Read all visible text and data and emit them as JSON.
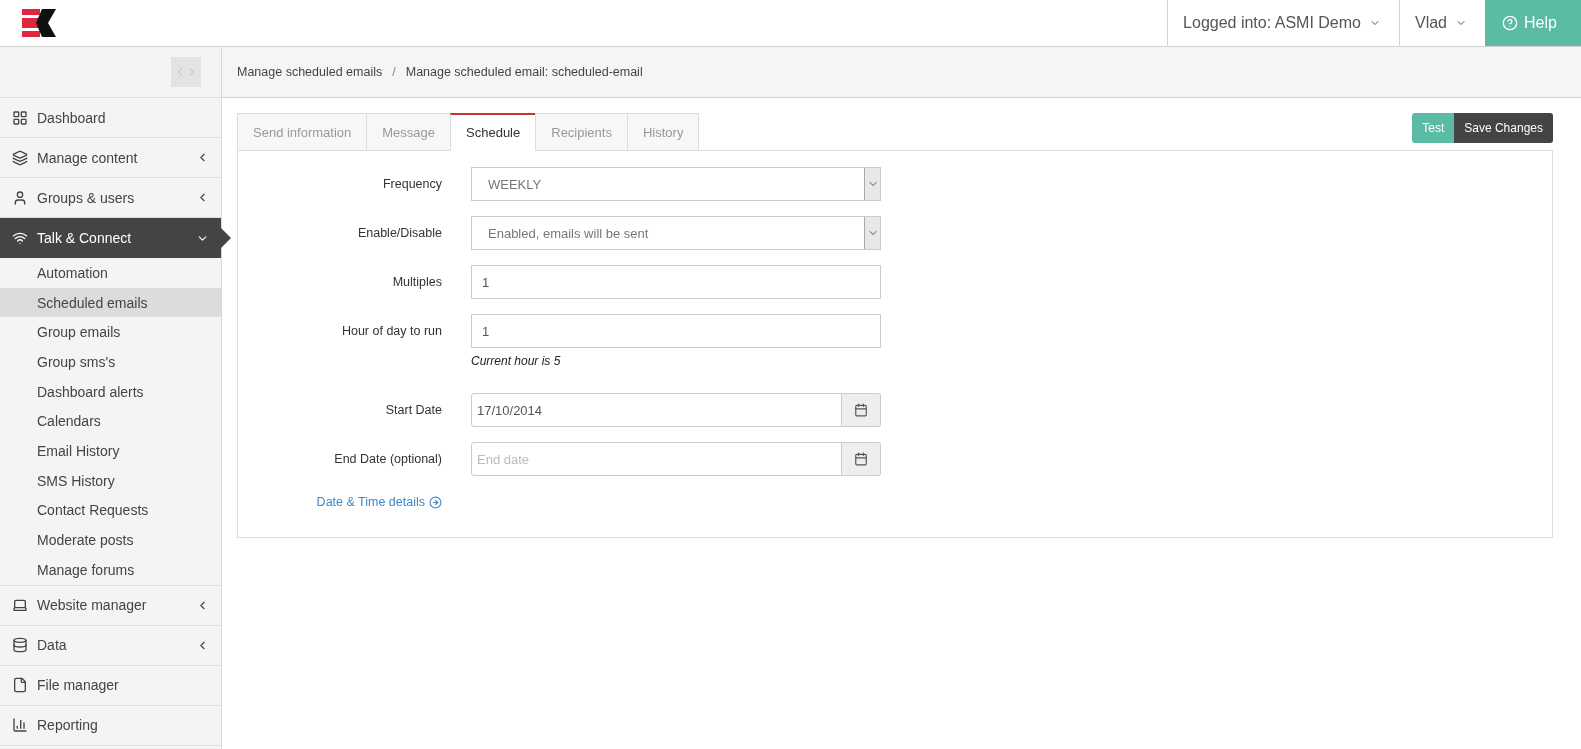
{
  "header": {
    "account_menu": "Logged into: ASMI Demo",
    "user_menu": "Vlad",
    "help_button": "Help"
  },
  "sidebar": {
    "items": [
      {
        "label": "Dashboard",
        "kind": "link",
        "selected": false
      },
      {
        "label": "Manage content",
        "kind": "menu",
        "selected": false,
        "expanded": false
      },
      {
        "label": "Groups & users",
        "kind": "menu",
        "selected": false,
        "expanded": false
      },
      {
        "label": "Talk & Connect",
        "kind": "menu",
        "selected": true,
        "expanded": true,
        "children": [
          {
            "label": "Automation",
            "selected": false
          },
          {
            "label": "Scheduled emails",
            "selected": true
          },
          {
            "label": "Group emails",
            "selected": false
          },
          {
            "label": "Group sms's",
            "selected": false
          },
          {
            "label": "Dashboard alerts",
            "selected": false
          },
          {
            "label": "Calendars",
            "selected": false
          },
          {
            "label": "Email History",
            "selected": false
          },
          {
            "label": "SMS History",
            "selected": false
          },
          {
            "label": "Contact Requests",
            "selected": false
          },
          {
            "label": "Moderate posts",
            "selected": false
          },
          {
            "label": "Manage forums",
            "selected": false
          }
        ]
      },
      {
        "label": "Website manager",
        "kind": "menu",
        "selected": false,
        "expanded": false
      },
      {
        "label": "Data",
        "kind": "menu",
        "selected": false,
        "expanded": false
      },
      {
        "label": "File manager",
        "kind": "link",
        "selected": false
      },
      {
        "label": "Reporting",
        "kind": "link",
        "selected": false
      }
    ]
  },
  "breadcrumb": [
    "Manage scheduled emails",
    "Manage scheduled email: scheduled-email"
  ],
  "breadcrumb_separator": "/",
  "tabs": [
    {
      "label": "Send information",
      "selected": false
    },
    {
      "label": "Message",
      "selected": false
    },
    {
      "label": "Schedule",
      "selected": true
    },
    {
      "label": "Recipients",
      "selected": false
    },
    {
      "label": "History",
      "selected": false
    }
  ],
  "buttons": [
    {
      "label": "Test",
      "kind": "secondary"
    },
    {
      "label": "Save Changes",
      "kind": "primary"
    }
  ],
  "form": [
    {
      "label": "Frequency",
      "kind": "select",
      "value": "WEEKLY"
    },
    {
      "label": "Enable/Disable",
      "kind": "select",
      "value": "Enabled, emails will be sent"
    },
    {
      "label": "Multiples",
      "kind": "text",
      "value": "1"
    },
    {
      "label": "Hour of day to run",
      "kind": "text",
      "value": "1",
      "help": "Current hour is 5"
    },
    {
      "label": "Start Date",
      "kind": "date",
      "value": "17/10/2014"
    },
    {
      "label": "End Date (optional)",
      "kind": "date",
      "placeholder": "End date"
    }
  ],
  "details_link": "Date & Time details"
}
